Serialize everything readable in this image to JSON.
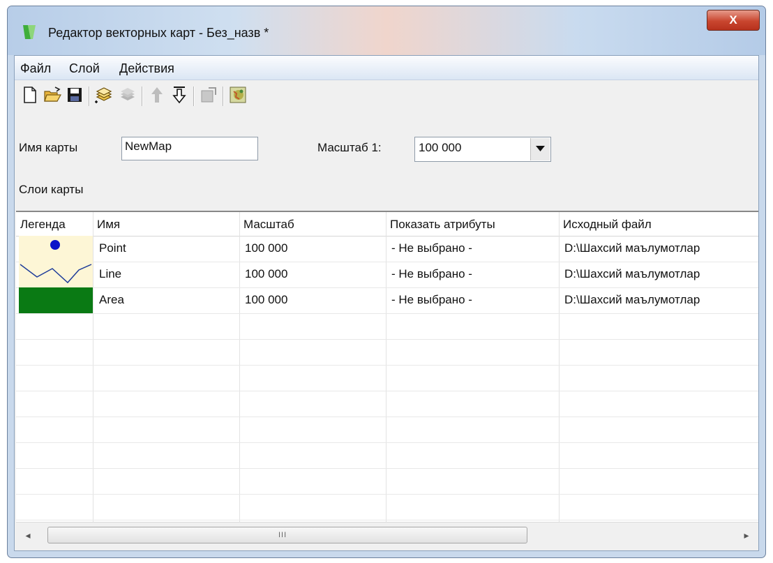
{
  "window": {
    "title": "Редактор векторных карт - Без_назв *",
    "close_label": "X"
  },
  "menu": [
    "Файл",
    "Слой",
    "Действия"
  ],
  "toolbar": {
    "icons": [
      "new-file-icon",
      "open-folder-icon",
      "save-disk-icon",
      "add-layer-icon",
      "remove-layer-icon",
      "move-up-icon",
      "move-down-icon",
      "layer-properties-icon",
      "map-image-icon"
    ]
  },
  "form": {
    "map_name_label": "Имя карты",
    "map_name_value": "NewMap",
    "scale_label": "Масштаб 1:",
    "scale_value": "100 000"
  },
  "layers_label": "Слои карты",
  "table": {
    "columns": [
      "Легенда",
      "Имя",
      "Масштаб",
      "Показать атрибуты",
      "Исходный файл"
    ],
    "rows": [
      {
        "legend": "point",
        "name": "Point",
        "scale": "100 000",
        "attributes": "- Не выбрано -",
        "file": "D:\\Шахсий маълумотлар"
      },
      {
        "legend": "line",
        "name": "Line",
        "scale": "100 000",
        "attributes": "- Не выбрано -",
        "file": "D:\\Шахсий маълумотлар"
      },
      {
        "legend": "area",
        "name": "Area",
        "scale": "100 000",
        "attributes": "- Не выбрано -",
        "file": "D:\\Шахсий маълумотлар"
      }
    ]
  },
  "scrollbar": {
    "left_arrow": "◂",
    "right_arrow": "▸",
    "grip": "III"
  },
  "colors": {
    "point": "#0a14c8",
    "line": "#1e3c9a",
    "area": "#0a7a14",
    "legend_bg": "#fdf6d6"
  }
}
